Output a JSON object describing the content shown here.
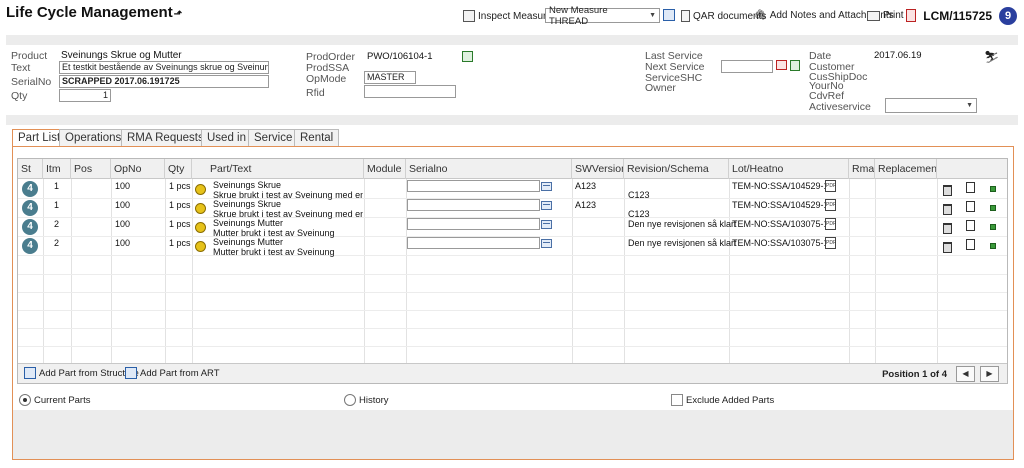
{
  "app": {
    "title": "Life Cycle Management",
    "pin_glyph": "⬏"
  },
  "header": {
    "inspect_measures": "Inspect Measures",
    "measure_select": "New Measure THREAD",
    "qar_documents": "QAR documents",
    "add_notes": "Add Notes and Attachments",
    "print": "Print",
    "lcm_id": "LCM/115725",
    "badge_count": "9"
  },
  "info": {
    "product_label": "Product",
    "product_value": "Sveinungs Skrue og Mutter",
    "text_label": "Text",
    "text_value": "Et testkit bestående av Sveinungs skrue og Sveinungs mutte",
    "serialno_label": "SerialNo",
    "serialno_value": "SCRAPPED 2017.06.191725",
    "qty_label": "Qty",
    "qty_value": "1",
    "prodorder_label": "ProdOrder",
    "prodorder_value": "PWO/106104-1",
    "prodssa_label": "ProdSSA",
    "opmode_label": "OpMode",
    "opmode_value": "MASTER",
    "rfid_label": "Rfid",
    "rfid_value": "",
    "last_service_label": "Last Service",
    "next_service_label": "Next Service",
    "service_shc_label": "ServiceSHC",
    "owner_label": "Owner",
    "date_label": "Date",
    "date_value": "2017.06.19",
    "customer_label": "Customer",
    "cusshipdoc_label": "CusShipDoc",
    "yourno_label": "YourNo",
    "cdvref_label": "CdvRef",
    "activeservice_label": "Activeservice"
  },
  "tabs": [
    "Part List",
    "Operations",
    "RMA Requests",
    "Used in",
    "Service",
    "Rental"
  ],
  "grid": {
    "columns": [
      "St",
      "Itm",
      "Pos",
      "OpNo",
      "Qty",
      "Part/Text",
      "Module",
      "Serialno",
      "SWVersion",
      "Revision/Schema",
      "Lot/Heatno",
      "Rma",
      "Replacement"
    ],
    "rows": [
      {
        "st": "4",
        "itm": "1",
        "pos": "",
        "opno": "100",
        "qty": "1 pcs",
        "part": "Sveinungs Skrue",
        "text": "Skrue brukt i test av Sveinung med en de",
        "sw": "A123",
        "rev": "C123",
        "lot": "TEM-NO:SSA/104529-1"
      },
      {
        "st": "4",
        "itm": "1",
        "pos": "",
        "opno": "100",
        "qty": "1 pcs",
        "part": "Sveinungs Skrue",
        "text": "Skrue brukt i test av Sveinung med en de",
        "sw": "A123",
        "rev": "C123",
        "lot": "TEM-NO:SSA/104529-1"
      },
      {
        "st": "4",
        "itm": "2",
        "pos": "",
        "opno": "100",
        "qty": "1 pcs",
        "part": "Sveinungs Mutter",
        "text": "Mutter brukt i test av Sveinung",
        "sw": "",
        "rev": "Den nye revisjonen så klart",
        "lot": "TEM-NO:SSA/103075-1"
      },
      {
        "st": "4",
        "itm": "2",
        "pos": "",
        "opno": "100",
        "qty": "1 pcs",
        "part": "Sveinungs Mutter",
        "text": "Mutter brukt i test av Sveinung",
        "sw": "",
        "rev": "Den nye revisjonen så klart",
        "lot": "TEM-NO:SSA/103075-1"
      }
    ],
    "add_from_structure": "Add Part from Structure",
    "add_from_art": "Add Part from ART",
    "position": "Position 1 of 4",
    "prev": "◀",
    "next": "▶"
  },
  "options": {
    "current_parts": "Current Parts",
    "history": "History",
    "exclude_added": "Exclude Added Parts"
  }
}
